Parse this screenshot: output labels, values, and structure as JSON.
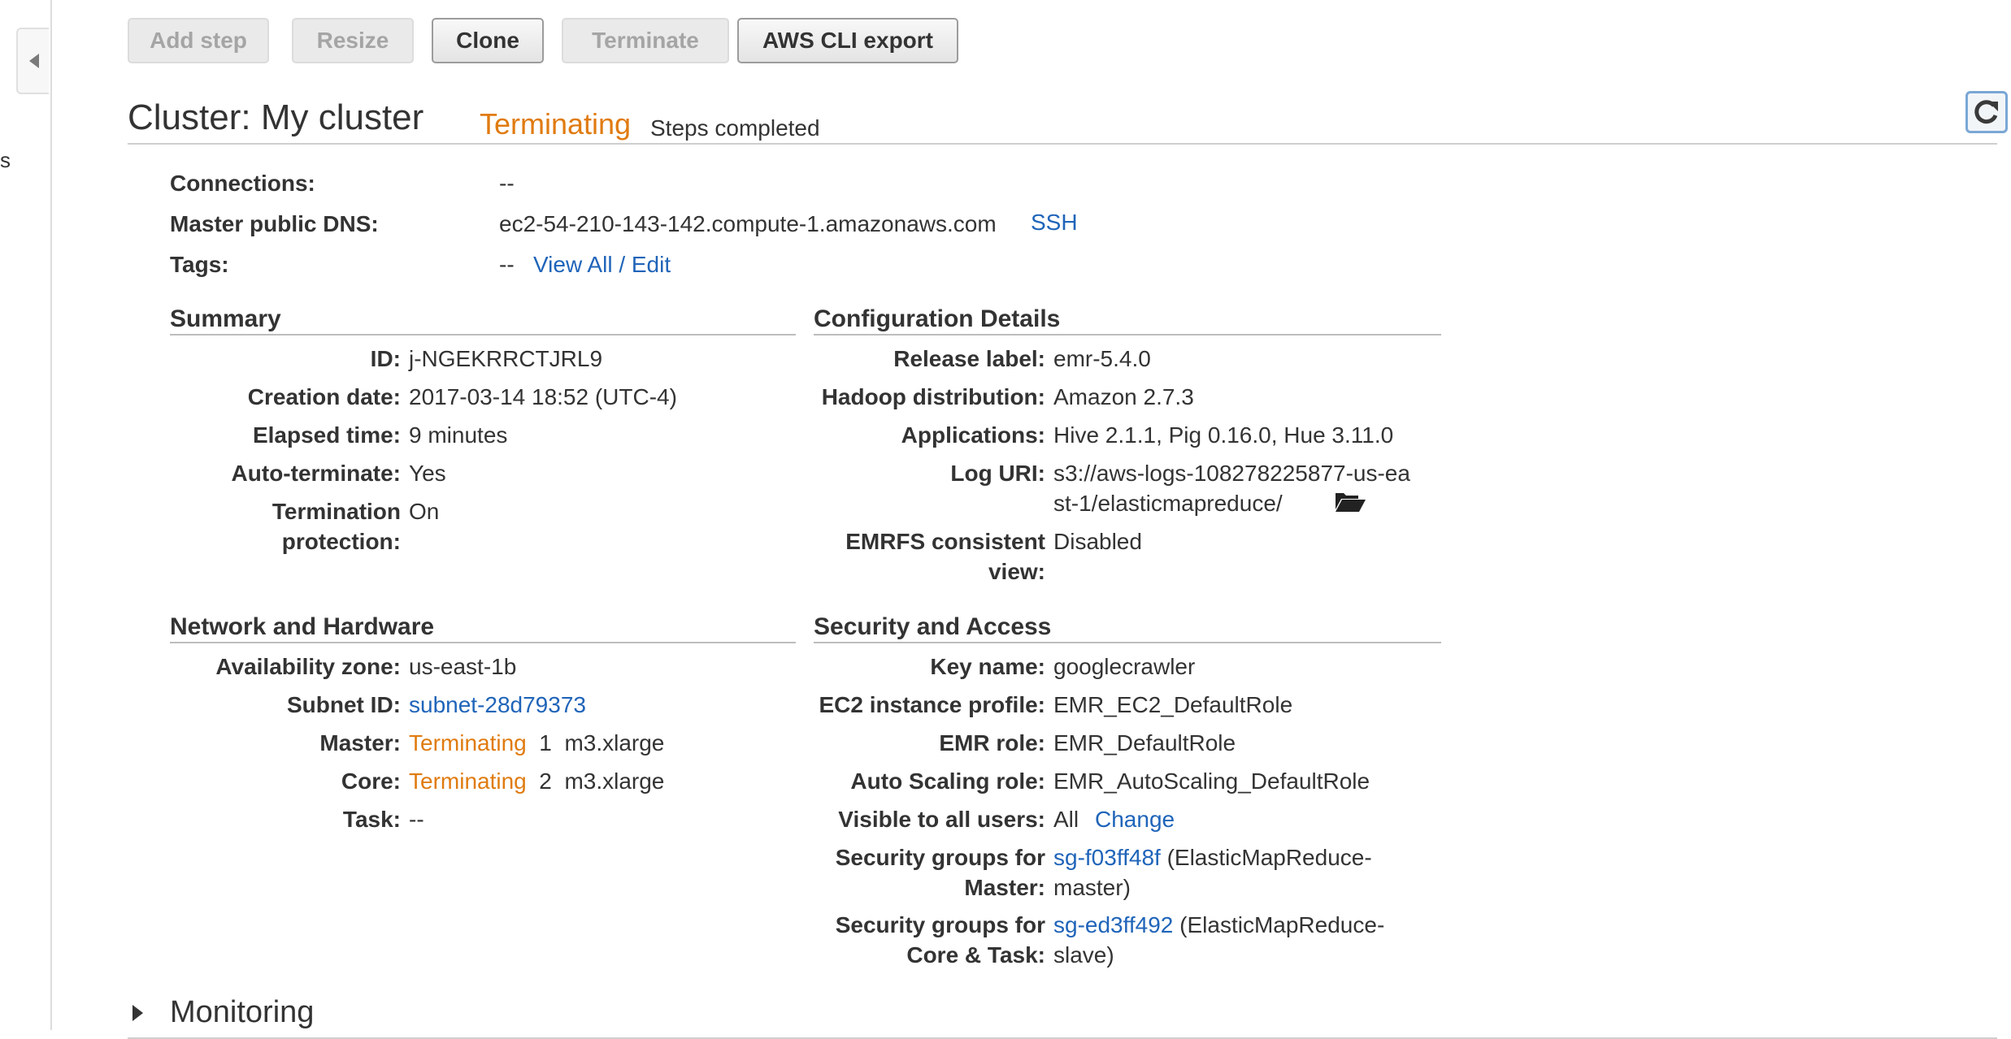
{
  "sidebar": {
    "partial_text": "s"
  },
  "toolbar": {
    "add_step": "Add step",
    "resize": "Resize",
    "clone": "Clone",
    "terminate": "Terminate",
    "cli_export": "AWS CLI export"
  },
  "cluster": {
    "title": "Cluster: My cluster",
    "state": "Terminating",
    "state_detail": "Steps completed"
  },
  "overview": {
    "connections_label": "Connections:",
    "connections_value": "--",
    "dns_label": "Master public DNS:",
    "dns_value": "ec2-54-210-143-142.compute-1.amazonaws.com",
    "ssh_link": "SSH",
    "tags_label": "Tags:",
    "tags_value": "--",
    "tags_link": "View All / Edit"
  },
  "summary": {
    "heading": "Summary",
    "id_label": "ID:",
    "id_value": "j-NGEKRRCTJRL9",
    "creation_label": "Creation date:",
    "creation_value": "2017-03-14 18:52 (UTC-4)",
    "elapsed_label": "Elapsed time:",
    "elapsed_value": "9 minutes",
    "autoterm_label": "Auto-terminate:",
    "autoterm_value": "Yes",
    "protection_label": "Termination protection:",
    "protection_value": "On"
  },
  "config": {
    "heading": "Configuration Details",
    "release_label": "Release label:",
    "release_value": "emr-5.4.0",
    "hadoop_label": "Hadoop distribution:",
    "hadoop_value": "Amazon 2.7.3",
    "apps_label": "Applications:",
    "apps_value": "Hive 2.1.1, Pig 0.16.0, Hue 3.11.0",
    "log_label": "Log URI:",
    "log_value": "s3://aws-logs-108278225877-us-east-1/elasticmapreduce/",
    "emrfs_label": "EMRFS consistent view:",
    "emrfs_value": "Disabled"
  },
  "network": {
    "heading": "Network and Hardware",
    "az_label": "Availability zone:",
    "az_value": "us-east-1b",
    "subnet_label": "Subnet ID:",
    "subnet_value": "subnet-28d79373",
    "master_label": "Master:",
    "master_state": "Terminating",
    "master_count": "1",
    "master_type": "m3.xlarge",
    "core_label": "Core:",
    "core_state": "Terminating",
    "core_count": "2",
    "core_type": "m3.xlarge",
    "task_label": "Task:",
    "task_value": "--"
  },
  "security": {
    "heading": "Security and Access",
    "key_label": "Key name:",
    "key_value": "googlecrawler",
    "ec2_profile_label": "EC2 instance profile:",
    "ec2_profile_value": "EMR_EC2_DefaultRole",
    "emr_role_label": "EMR role:",
    "emr_role_value": "EMR_DefaultRole",
    "autoscaling_label": "Auto Scaling role:",
    "autoscaling_value": "EMR_AutoScaling_DefaultRole",
    "visible_label": "Visible to all users:",
    "visible_value": "All",
    "visible_link": "Change",
    "sg_master_label": "Security groups for Master:",
    "sg_master_link": "sg-f03ff48f",
    "sg_master_desc": "(ElasticMapReduce-master)",
    "sg_core_label": "Security groups for Core & Task:",
    "sg_core_link": "sg-ed3ff492",
    "sg_core_desc": "(ElasticMapReduce-slave)"
  },
  "monitoring": {
    "label": "Monitoring"
  },
  "colors": {
    "terminating": "#e07b10",
    "link": "#1f64b9",
    "text": "#333333"
  }
}
